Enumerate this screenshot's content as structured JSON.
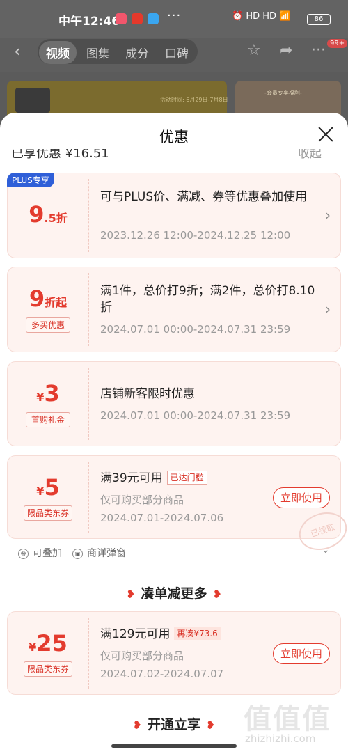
{
  "status_bar": {
    "time": "中午12:46",
    "more": "···",
    "signal_text": "HD HD",
    "battery": "86"
  },
  "top_nav": {
    "tabs": [
      "视频",
      "图集",
      "成分",
      "口碑"
    ],
    "active_tab": "视频",
    "badge": "99+"
  },
  "banner": {
    "activity_time": "活动时间: 6月29日-7月8日",
    "member_text": "-会员专享福利-"
  },
  "sheet": {
    "title": "优惠",
    "cut_left": "已享优惠 ¥16.51",
    "cut_right": "收起"
  },
  "cards": [
    {
      "badge": "PLUS专享",
      "amount_big": "9",
      "amount_small": ".5折",
      "tag": "",
      "desc": "可与PLUS价、满减、券等优惠叠加使用",
      "date": "2023.12.26 12:00-2024.12.25 12:00"
    },
    {
      "amount_big": "9",
      "amount_small": "折起",
      "tag": "多买优惠",
      "desc": "满1件，总价打9折；满2件，总价打8.10折",
      "date": "2024.07.01 00:00-2024.07.31 23:59"
    },
    {
      "amount_prefix": "¥",
      "amount_big": "3",
      "tag": "首购礼金",
      "desc": "店铺新客限时优惠",
      "date": "2024.07.01 00:00-2024.07.31 23:59"
    },
    {
      "amount_prefix": "¥",
      "amount_big": "5",
      "tag": "限品类东券",
      "desc": "满39元可用",
      "label": "已达门槛",
      "sub": "仅可购买部分商品",
      "date": "2024.07.01-2024.07.06",
      "button": "立即使用",
      "stamp": "已领取"
    },
    {
      "amount_prefix": "¥",
      "amount_big": "25",
      "tag": "限品类东券",
      "desc": "满129元可用",
      "label": "再凑¥73.6",
      "sub": "仅可购买部分商品",
      "date": "2024.07.02-2024.07.07",
      "button": "立即使用"
    }
  ],
  "features": {
    "stackable": "可叠加",
    "popup": "商详弹窗"
  },
  "sections": {
    "more_savings": "凑单减更多",
    "open_enjoy": "开通立享"
  },
  "watermark": {
    "logo": "值值值",
    "url": "zhizhizhi.com"
  }
}
